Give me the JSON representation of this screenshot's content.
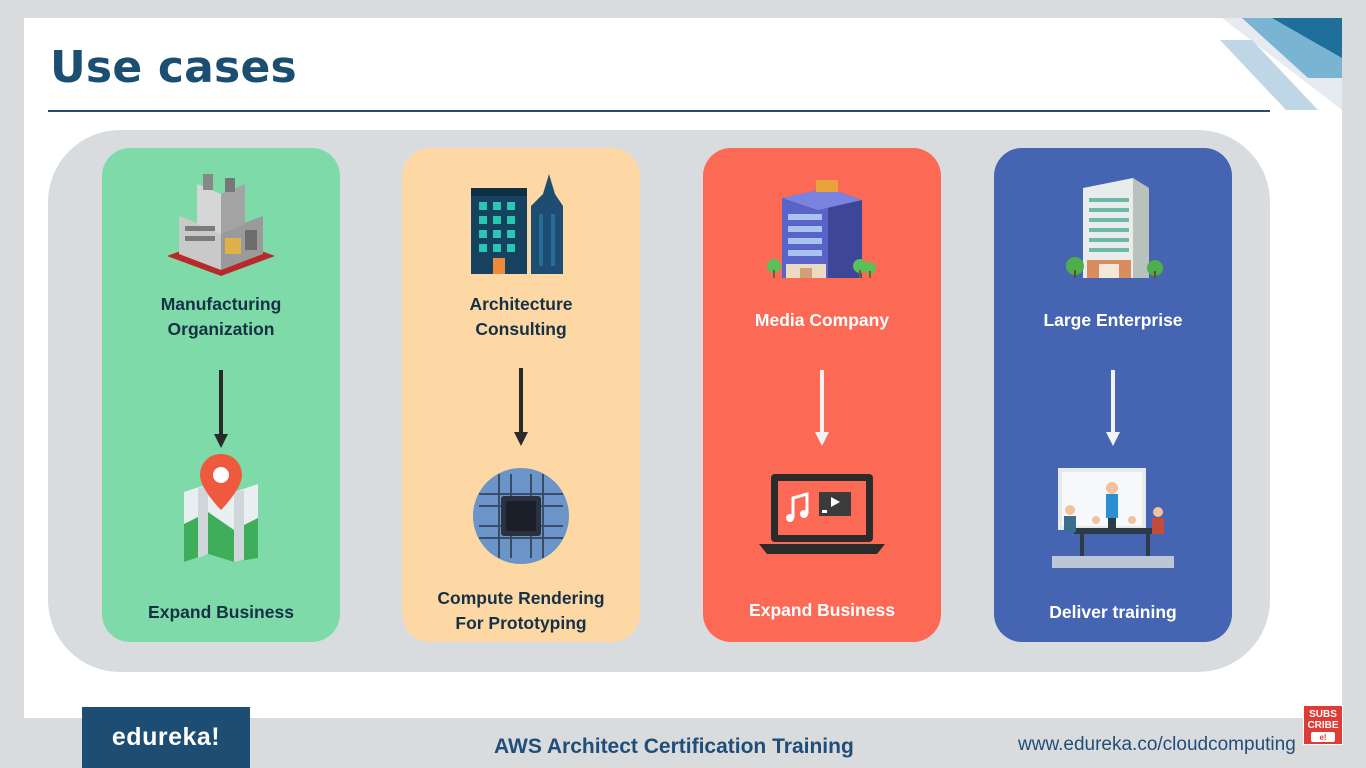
{
  "slide": {
    "title": "Use cases"
  },
  "cards": [
    {
      "name": "Manufacturing\nOrganization",
      "name_line1": "Manufacturing",
      "name_line2": "Organization",
      "top_icon": "factory-icon",
      "bottom_icon": "map-pin-icon",
      "result": "Expand Business",
      "result_line1": "Expand Business",
      "result_line2": "",
      "bg": "#7edba9",
      "text_color": "#163046"
    },
    {
      "name_line1": "Architecture",
      "name_line2": "Consulting",
      "top_icon": "skyscrapers-icon",
      "bottom_icon": "cpu-chip-icon",
      "result_line1": "Compute Rendering",
      "result_line2": "For Prototyping",
      "bg": "#fdd8a4",
      "text_color": "#163046"
    },
    {
      "name_line1": "Media Company",
      "top_icon": "office-building-icon",
      "bottom_icon": "laptop-media-icon",
      "result_line1": "Expand Business",
      "bg": "#fc6a56",
      "text_color": "#ffffff"
    },
    {
      "name_line1": "Large Enterprise",
      "top_icon": "tower-building-icon",
      "bottom_icon": "meeting-training-icon",
      "result_line1": "Deliver training",
      "bg": "#4565b3",
      "text_color": "#ffffff"
    }
  ],
  "footer": {
    "logo": "edureka!",
    "course": "AWS Architect Certification Training",
    "url": "www.edureka.co/cloudcomputing"
  },
  "subscribe_badge": {
    "line1": "SUBS",
    "line2": "CRIBE",
    "line3": "e!"
  },
  "colors": {
    "title": "#1b4f72",
    "panel": "#d9dcdf"
  }
}
